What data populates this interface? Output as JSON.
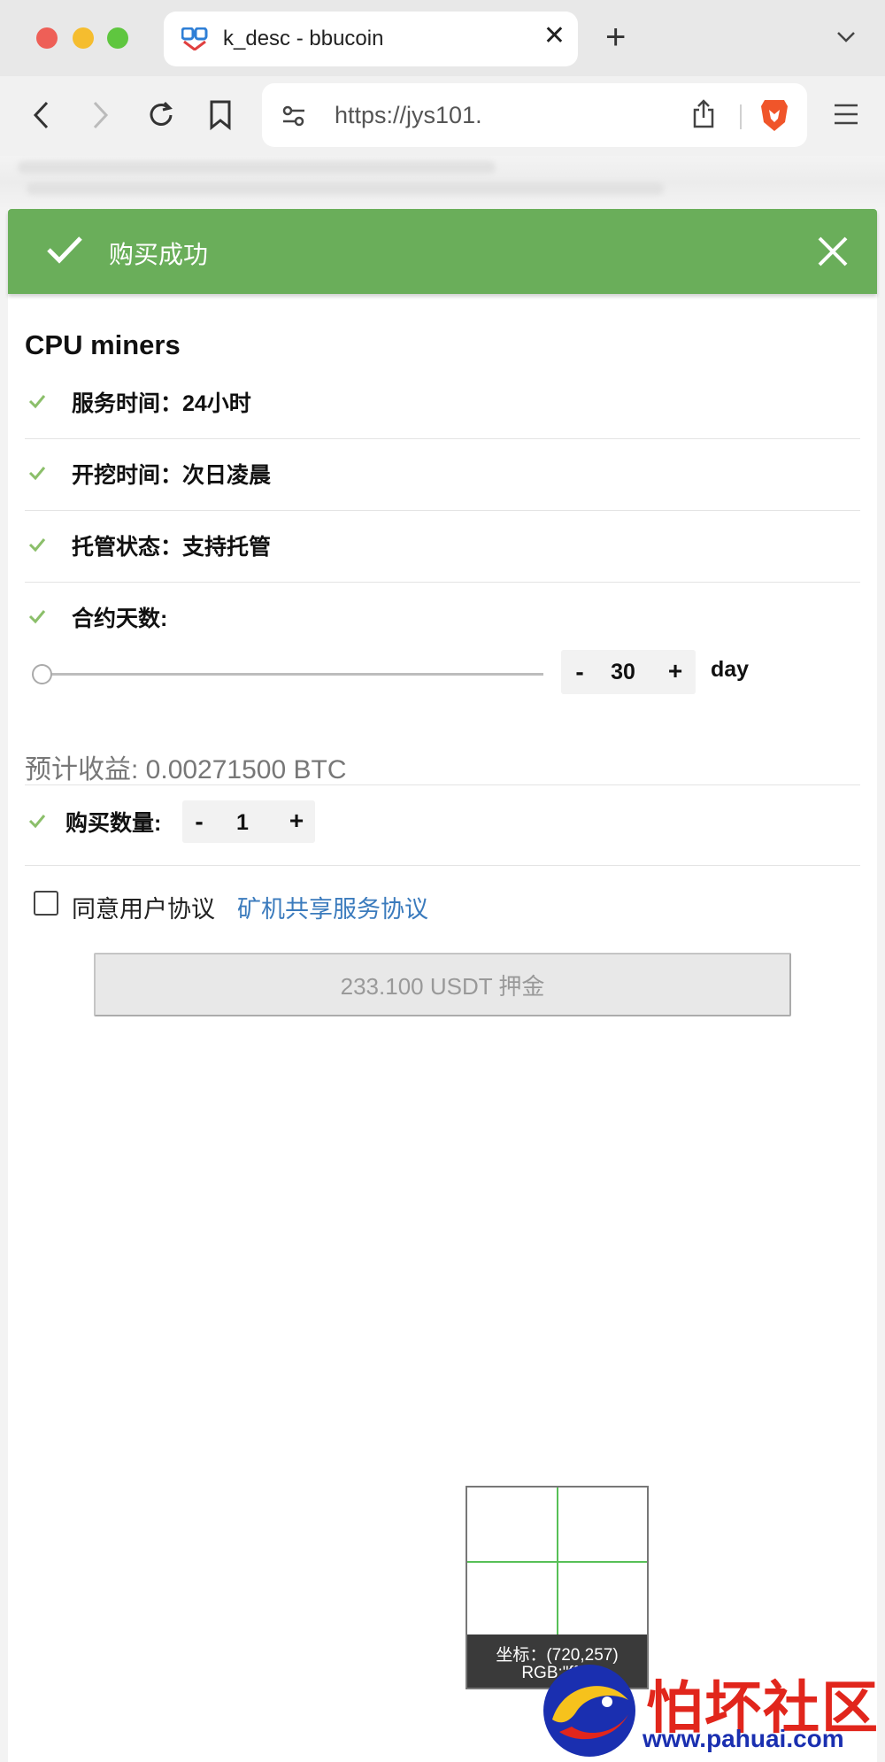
{
  "browser": {
    "tab_title": "k_desc - bbucoin",
    "tab_close": "✕",
    "new_tab": "+",
    "url": "https://jys101."
  },
  "toast": {
    "message": "购买成功"
  },
  "product": {
    "title": "CPU miners",
    "features": [
      {
        "label": "服务时间：24小时"
      },
      {
        "label": "开挖时间：次日凌晨"
      },
      {
        "label": "托管状态：支持托管"
      },
      {
        "label": "合约天数:"
      }
    ]
  },
  "contract_days": {
    "minus": "-",
    "value": "30",
    "plus": "+",
    "unit": "day",
    "slider_position": 0
  },
  "estimate": {
    "text": "预计收益: 0.00271500 BTC"
  },
  "quantity": {
    "label": "购买数量:",
    "minus": "-",
    "value": "1",
    "plus": "+"
  },
  "agreement": {
    "checked": false,
    "label": "同意用户协议",
    "link_text": "矿机共享服务协议"
  },
  "submit": {
    "label": "233.100 USDT 押金"
  },
  "picker": {
    "coord_text": "坐标：(720,257)",
    "rgb_text": "RGB:\"ff\"ff"
  },
  "watermark": {
    "text": "怕坏社区",
    "url": "www.pahuai.com"
  },
  "colors": {
    "toast_bg": "#6aae5a",
    "check_green": "#8bbf6a",
    "link_blue": "#3b7bbd",
    "watermark_red": "#e1261c"
  }
}
